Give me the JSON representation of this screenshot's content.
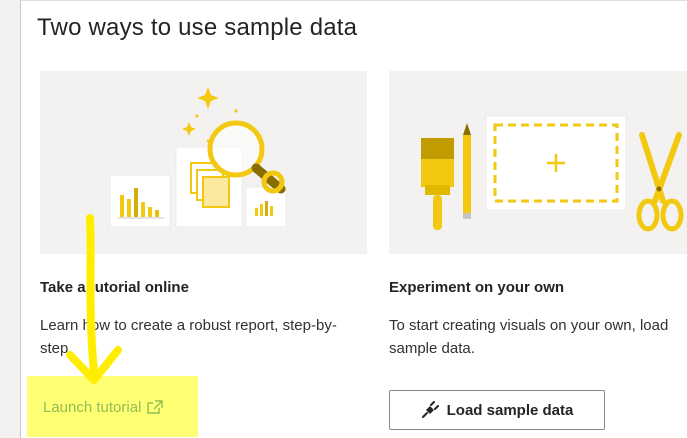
{
  "dialog": {
    "title": "Two ways to use sample data"
  },
  "cards": [
    {
      "title": "Take a tutorial online",
      "description": "Learn how to create a robust report, step-by-step.",
      "action_label": "Launch tutorial",
      "action_icon": "external-link-icon"
    },
    {
      "title": "Experiment on your own",
      "description": "To start creating visuals on your own, load sample data.",
      "action_label": "Load sample data",
      "action_icon": "plug-icon"
    }
  ],
  "colors": {
    "accent_yellow": "#f2c811",
    "link_blue": "#0f6cbd",
    "annotation_highlight": "#ffff00"
  }
}
